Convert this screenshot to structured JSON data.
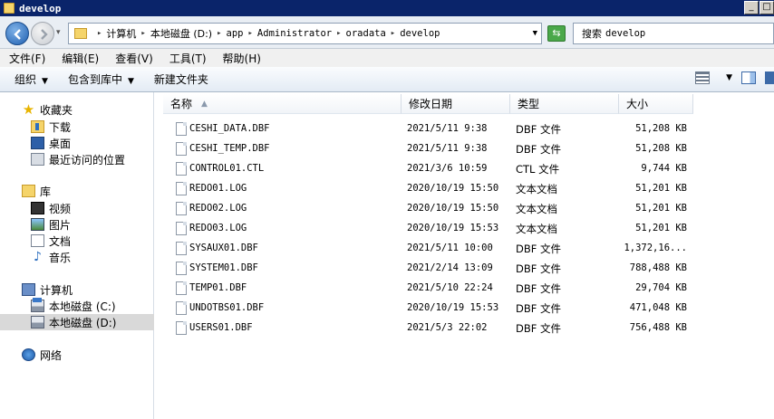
{
  "window": {
    "title": "develop",
    "buttons": [
      "_",
      "□"
    ]
  },
  "address": {
    "crumbs": [
      "计算机",
      "本地磁盘 (D:)",
      "app",
      "Administrator",
      "oradata",
      "develop"
    ]
  },
  "search": {
    "label": "搜索",
    "scope": "develop"
  },
  "menu": [
    "文件(F)",
    "编辑(E)",
    "查看(V)",
    "工具(T)",
    "帮助(H)"
  ],
  "toolbar": {
    "organize": "组织",
    "include": "包含到库中",
    "new_folder": "新建文件夹"
  },
  "nav": {
    "favorites": "收藏夹",
    "downloads": "下载",
    "desktop": "桌面",
    "recent": "最近访问的位置",
    "libraries": "库",
    "videos": "视频",
    "pictures": "图片",
    "documents": "文档",
    "music": "音乐",
    "computer": "计算机",
    "drive_c": "本地磁盘 (C:)",
    "drive_d": "本地磁盘 (D:)",
    "network": "网络"
  },
  "columns": {
    "name": "名称",
    "date": "修改日期",
    "type": "类型",
    "size": "大小"
  },
  "files": [
    {
      "name": "CESHI_DATA.DBF",
      "date": "2021/5/11 9:38",
      "type": "DBF 文件",
      "size": "51,208 KB"
    },
    {
      "name": "CESHI_TEMP.DBF",
      "date": "2021/5/11 9:38",
      "type": "DBF 文件",
      "size": "51,208 KB"
    },
    {
      "name": "CONTROL01.CTL",
      "date": "2021/3/6 10:59",
      "type": "CTL 文件",
      "size": "9,744 KB"
    },
    {
      "name": "REDO01.LOG",
      "date": "2020/10/19 15:50",
      "type": "文本文档",
      "size": "51,201 KB"
    },
    {
      "name": "REDO02.LOG",
      "date": "2020/10/19 15:50",
      "type": "文本文档",
      "size": "51,201 KB"
    },
    {
      "name": "REDO03.LOG",
      "date": "2020/10/19 15:53",
      "type": "文本文档",
      "size": "51,201 KB"
    },
    {
      "name": "SYSAUX01.DBF",
      "date": "2021/5/11 10:00",
      "type": "DBF 文件",
      "size": "1,372,16..."
    },
    {
      "name": "SYSTEM01.DBF",
      "date": "2021/2/14 13:09",
      "type": "DBF 文件",
      "size": "788,488 KB"
    },
    {
      "name": "TEMP01.DBF",
      "date": "2021/5/10 22:24",
      "type": "DBF 文件",
      "size": "29,704 KB"
    },
    {
      "name": "UNDOTBS01.DBF",
      "date": "2020/10/19 15:53",
      "type": "DBF 文件",
      "size": "471,048 KB"
    },
    {
      "name": "USERS01.DBF",
      "date": "2021/5/3 22:02",
      "type": "DBF 文件",
      "size": "756,488 KB"
    }
  ]
}
